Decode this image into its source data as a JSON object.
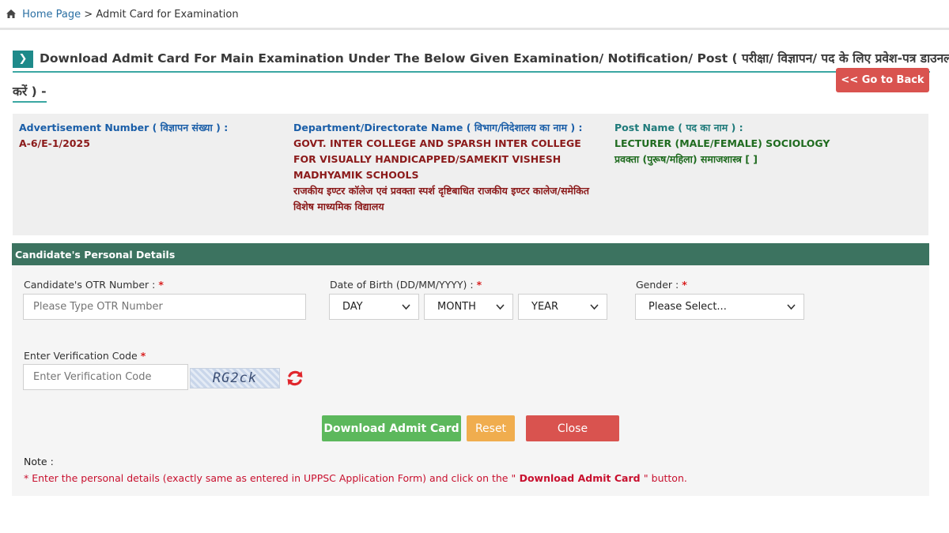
{
  "breadcrumb": {
    "home": "Home Page",
    "separator": ">",
    "current": "Admit Card for Examination"
  },
  "heading": {
    "line1": "Download Admit Card For Main Examination Under The Below Given Examination/ Notification/ Post ( परीक्षा/ विज्ञापन/ पद के लिए प्रवेश-पत्र डाउनलोड",
    "line2": "करें ) -"
  },
  "go_back_label": "<< Go to Back",
  "info": {
    "advertisement_label": "Advertisement Number ( विज्ञापन संख्या ) :",
    "advertisement_value": "A-6/E-1/2025",
    "department_label": "Department/Directorate Name ( विभाग/निदेशालय का नाम ) :",
    "department_value_en": "GOVT. INTER COLLEGE AND SPARSH INTER COLLEGE FOR VISUALLY HANDICAPPED/SAMEKIT VISHESH MADHYAMIK SCHOOLS",
    "department_value_hi": "राजकीय इण्टर कॉलेज एवं प्रवक्ता स्पर्श दृष्टिबाधित राजकीय इण्टर कालेज/समेकित विशेष माध्यमिक विद्यालय",
    "post_label": "Post Name ( पद का नाम ) :",
    "post_value_en": "LECTURER (MALE/FEMALE) SOCIOLOGY",
    "post_value_hi": "प्रवक्ता (पुरूष/महिला) समाजशास्त्र [ ]"
  },
  "section_title": "Candidate's Personal Details",
  "form": {
    "otr_label": "Candidate's OTR Number :",
    "otr_placeholder": "Please Type OTR Number",
    "dob_label": "Date of Birth (DD/MM/YYYY) :",
    "dob_day": "DAY",
    "dob_month": "MONTH",
    "dob_year": "YEAR",
    "gender_label": "Gender :",
    "gender_selected": "Please Select...",
    "verification_label": "Enter Verification Code",
    "verification_placeholder": "Enter Verification Code",
    "captcha_text": "RG2ck",
    "required_mark": "*"
  },
  "buttons": {
    "download": "Download Admit Card",
    "reset": "Reset",
    "close": "Close"
  },
  "note": {
    "title": "Note :",
    "text_prefix": "* Enter the personal details (exactly same as entered in UPPSC Application Form) and click on the \"",
    "text_bold": " Download Admit Card ",
    "text_suffix": "\" button."
  },
  "colors": {
    "section_bar": "#3c7360",
    "heading_accent": "#1e8a8a",
    "download": "#5cb85c",
    "reset": "#f0ad4e",
    "close": "#d9534f",
    "required": "#d92020"
  }
}
